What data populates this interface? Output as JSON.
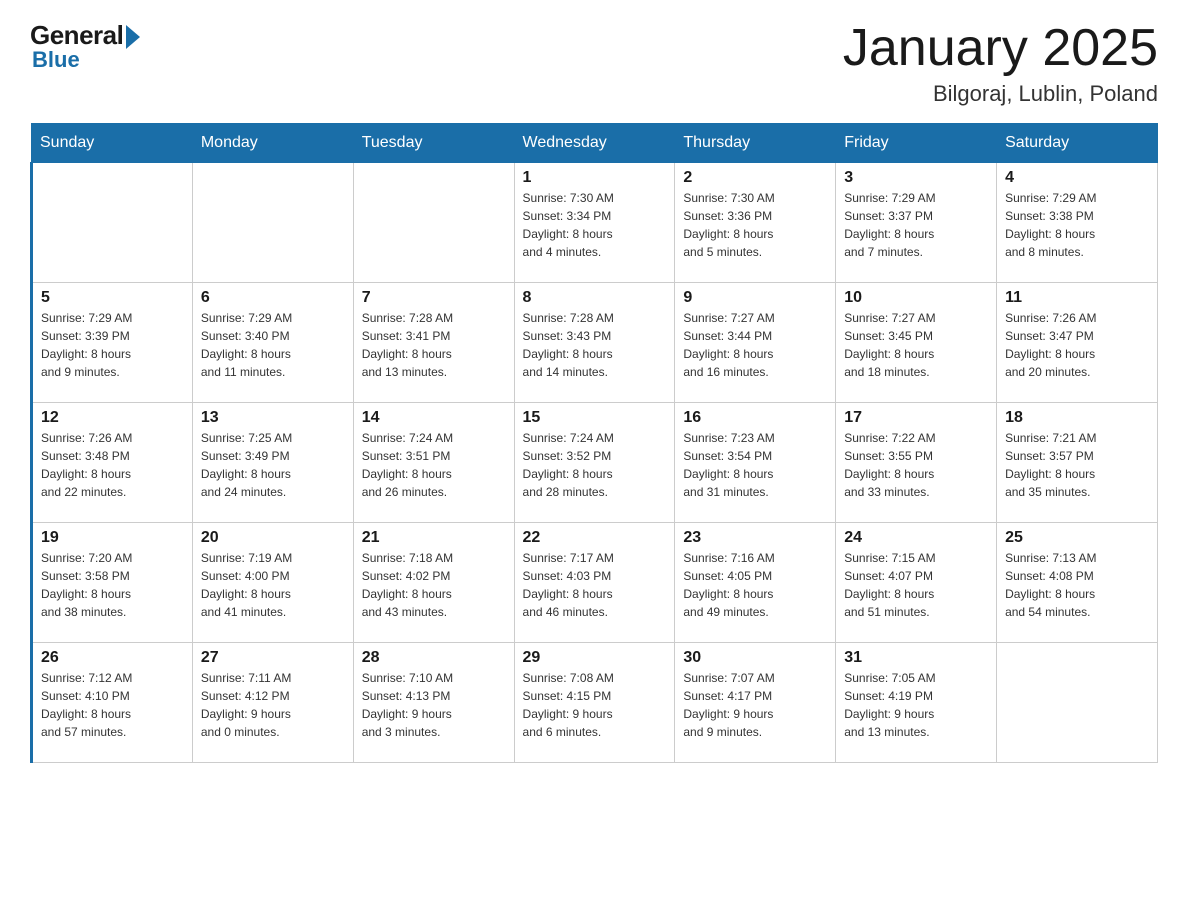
{
  "logo": {
    "general": "General",
    "blue": "Blue"
  },
  "calendar": {
    "title": "January 2025",
    "subtitle": "Bilgoraj, Lublin, Poland"
  },
  "headers": [
    "Sunday",
    "Monday",
    "Tuesday",
    "Wednesday",
    "Thursday",
    "Friday",
    "Saturday"
  ],
  "weeks": [
    [
      {
        "day": "",
        "info": ""
      },
      {
        "day": "",
        "info": ""
      },
      {
        "day": "",
        "info": ""
      },
      {
        "day": "1",
        "info": "Sunrise: 7:30 AM\nSunset: 3:34 PM\nDaylight: 8 hours\nand 4 minutes."
      },
      {
        "day": "2",
        "info": "Sunrise: 7:30 AM\nSunset: 3:36 PM\nDaylight: 8 hours\nand 5 minutes."
      },
      {
        "day": "3",
        "info": "Sunrise: 7:29 AM\nSunset: 3:37 PM\nDaylight: 8 hours\nand 7 minutes."
      },
      {
        "day": "4",
        "info": "Sunrise: 7:29 AM\nSunset: 3:38 PM\nDaylight: 8 hours\nand 8 minutes."
      }
    ],
    [
      {
        "day": "5",
        "info": "Sunrise: 7:29 AM\nSunset: 3:39 PM\nDaylight: 8 hours\nand 9 minutes."
      },
      {
        "day": "6",
        "info": "Sunrise: 7:29 AM\nSunset: 3:40 PM\nDaylight: 8 hours\nand 11 minutes."
      },
      {
        "day": "7",
        "info": "Sunrise: 7:28 AM\nSunset: 3:41 PM\nDaylight: 8 hours\nand 13 minutes."
      },
      {
        "day": "8",
        "info": "Sunrise: 7:28 AM\nSunset: 3:43 PM\nDaylight: 8 hours\nand 14 minutes."
      },
      {
        "day": "9",
        "info": "Sunrise: 7:27 AM\nSunset: 3:44 PM\nDaylight: 8 hours\nand 16 minutes."
      },
      {
        "day": "10",
        "info": "Sunrise: 7:27 AM\nSunset: 3:45 PM\nDaylight: 8 hours\nand 18 minutes."
      },
      {
        "day": "11",
        "info": "Sunrise: 7:26 AM\nSunset: 3:47 PM\nDaylight: 8 hours\nand 20 minutes."
      }
    ],
    [
      {
        "day": "12",
        "info": "Sunrise: 7:26 AM\nSunset: 3:48 PM\nDaylight: 8 hours\nand 22 minutes."
      },
      {
        "day": "13",
        "info": "Sunrise: 7:25 AM\nSunset: 3:49 PM\nDaylight: 8 hours\nand 24 minutes."
      },
      {
        "day": "14",
        "info": "Sunrise: 7:24 AM\nSunset: 3:51 PM\nDaylight: 8 hours\nand 26 minutes."
      },
      {
        "day": "15",
        "info": "Sunrise: 7:24 AM\nSunset: 3:52 PM\nDaylight: 8 hours\nand 28 minutes."
      },
      {
        "day": "16",
        "info": "Sunrise: 7:23 AM\nSunset: 3:54 PM\nDaylight: 8 hours\nand 31 minutes."
      },
      {
        "day": "17",
        "info": "Sunrise: 7:22 AM\nSunset: 3:55 PM\nDaylight: 8 hours\nand 33 minutes."
      },
      {
        "day": "18",
        "info": "Sunrise: 7:21 AM\nSunset: 3:57 PM\nDaylight: 8 hours\nand 35 minutes."
      }
    ],
    [
      {
        "day": "19",
        "info": "Sunrise: 7:20 AM\nSunset: 3:58 PM\nDaylight: 8 hours\nand 38 minutes."
      },
      {
        "day": "20",
        "info": "Sunrise: 7:19 AM\nSunset: 4:00 PM\nDaylight: 8 hours\nand 41 minutes."
      },
      {
        "day": "21",
        "info": "Sunrise: 7:18 AM\nSunset: 4:02 PM\nDaylight: 8 hours\nand 43 minutes."
      },
      {
        "day": "22",
        "info": "Sunrise: 7:17 AM\nSunset: 4:03 PM\nDaylight: 8 hours\nand 46 minutes."
      },
      {
        "day": "23",
        "info": "Sunrise: 7:16 AM\nSunset: 4:05 PM\nDaylight: 8 hours\nand 49 minutes."
      },
      {
        "day": "24",
        "info": "Sunrise: 7:15 AM\nSunset: 4:07 PM\nDaylight: 8 hours\nand 51 minutes."
      },
      {
        "day": "25",
        "info": "Sunrise: 7:13 AM\nSunset: 4:08 PM\nDaylight: 8 hours\nand 54 minutes."
      }
    ],
    [
      {
        "day": "26",
        "info": "Sunrise: 7:12 AM\nSunset: 4:10 PM\nDaylight: 8 hours\nand 57 minutes."
      },
      {
        "day": "27",
        "info": "Sunrise: 7:11 AM\nSunset: 4:12 PM\nDaylight: 9 hours\nand 0 minutes."
      },
      {
        "day": "28",
        "info": "Sunrise: 7:10 AM\nSunset: 4:13 PM\nDaylight: 9 hours\nand 3 minutes."
      },
      {
        "day": "29",
        "info": "Sunrise: 7:08 AM\nSunset: 4:15 PM\nDaylight: 9 hours\nand 6 minutes."
      },
      {
        "day": "30",
        "info": "Sunrise: 7:07 AM\nSunset: 4:17 PM\nDaylight: 9 hours\nand 9 minutes."
      },
      {
        "day": "31",
        "info": "Sunrise: 7:05 AM\nSunset: 4:19 PM\nDaylight: 9 hours\nand 13 minutes."
      },
      {
        "day": "",
        "info": ""
      }
    ]
  ]
}
